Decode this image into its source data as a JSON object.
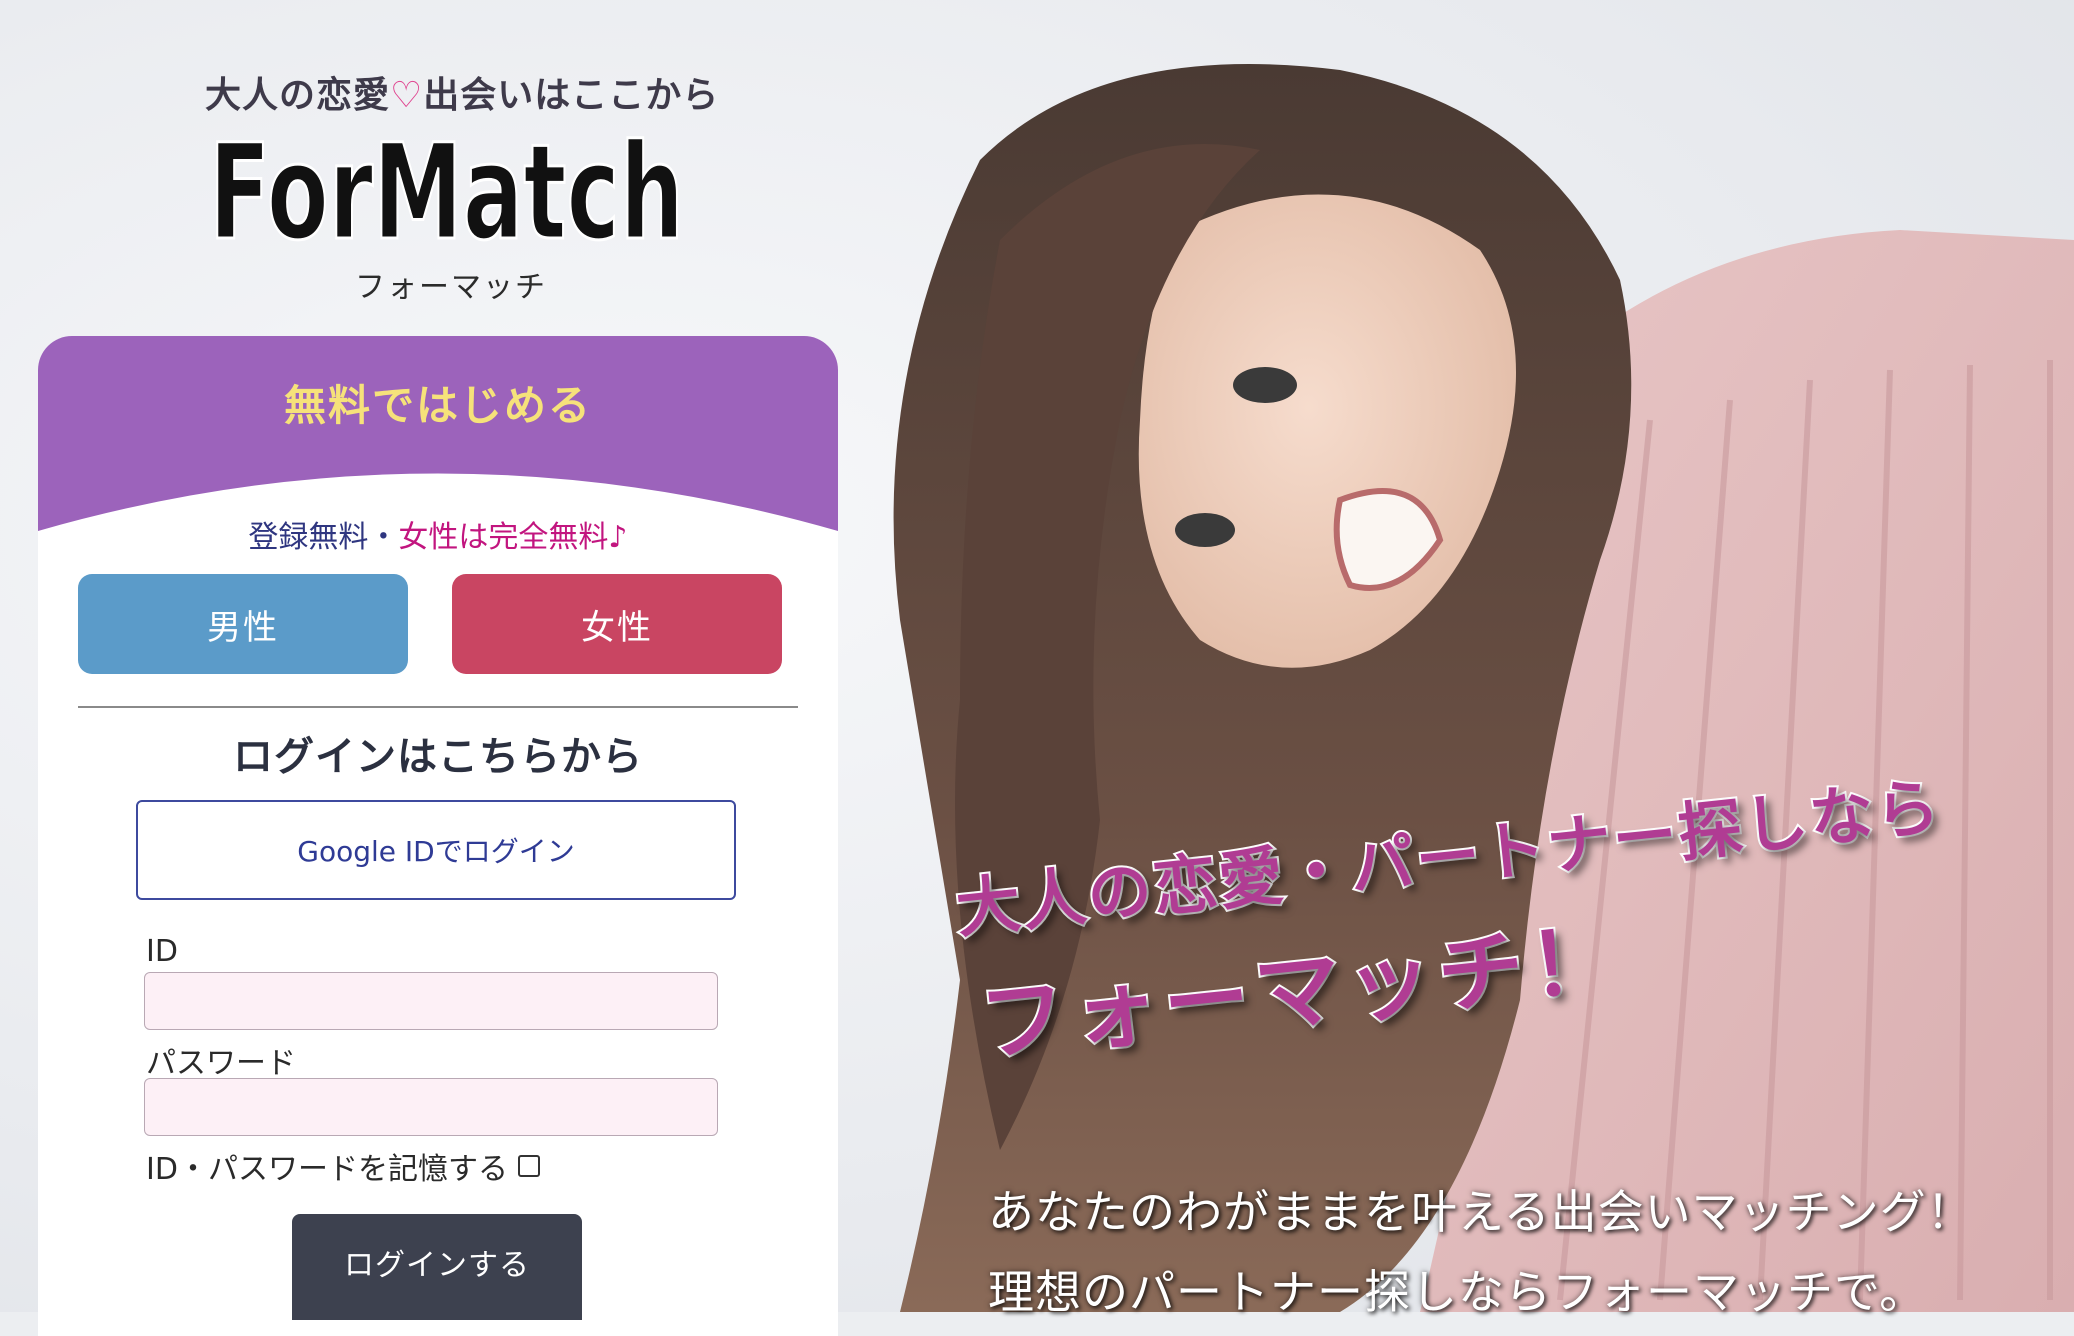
{
  "header": {
    "tagline_pre": "大人の恋愛",
    "tagline_heart": "♡",
    "tagline_post": "出会いはここから",
    "logo_text": "ForMatch",
    "logo_kana": "フォーマッチ"
  },
  "signup": {
    "title": "無料ではじめる",
    "note_a": "登録無料・",
    "note_b": "女性は完全無料♪",
    "male_label": "男性",
    "female_label": "女性"
  },
  "login": {
    "title": "ログインはこちらから",
    "google_label": "Google IDでログイン",
    "id_label": "ID",
    "id_value": "",
    "password_label": "パスワード",
    "password_value": "",
    "remember_label": "ID・パスワードを記憶する",
    "remember_checked": false,
    "submit_label": "ログインする"
  },
  "hero": {
    "catch_line1": "大人の恋愛・パートナー探しなら",
    "catch_line2": "フォーマッチ！",
    "sub_line1": "あなたのわがままを叶える出会いマッチング！",
    "sub_line2": "理想のパートナー探しならフォーマッチで。"
  },
  "colors": {
    "card_header": "#9c63bb",
    "male_button": "#5b9bc9",
    "female_button": "#c94562",
    "login_button": "#3d414f",
    "catch_text": "#b03c93",
    "brand_pink": "#d43a8c"
  }
}
